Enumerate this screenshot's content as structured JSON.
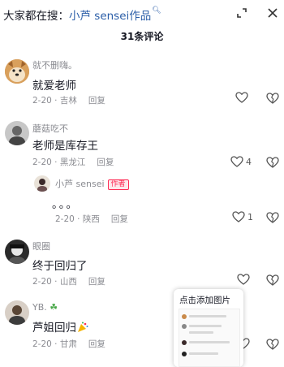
{
  "header": {
    "search_prefix": "大家都在搜：",
    "search_keyword": "小芦 sensei作品",
    "search_icon": "search-icon",
    "collapse_icon": "collapse-icon",
    "close_icon": "close-icon",
    "comment_count_title": "31条评论"
  },
  "comments": [
    {
      "username": "就不删嗨。",
      "text": "就爱老师",
      "date": "2-20 · 吉林",
      "reply_label": "回复",
      "like_count": ""
    },
    {
      "username": "蘑菇吃不",
      "text": "老师是库存王",
      "date": "2-20 · 黑龙江",
      "reply_label": "回复",
      "like_count": "4"
    },
    {
      "username": "小芦 sensei",
      "author_tag": "作者",
      "text": "。。。",
      "date": "2-20 · 陕西",
      "reply_label": "回复",
      "like_count": "1"
    },
    {
      "username": "眼圈",
      "text": "终于回归了",
      "date": "2-20 · 山西",
      "reply_label": "回复",
      "like_count": ""
    },
    {
      "username": "YB.",
      "text": "芦姐回归",
      "date": "2-20 · 甘肃",
      "reply_label": "回复",
      "like_count": ""
    }
  ],
  "popup": {
    "title": "点击添加图片"
  },
  "colors": {
    "accent": "#fe2c55",
    "link": "#2b5ea8",
    "secondary_text": "#8a8b91"
  }
}
